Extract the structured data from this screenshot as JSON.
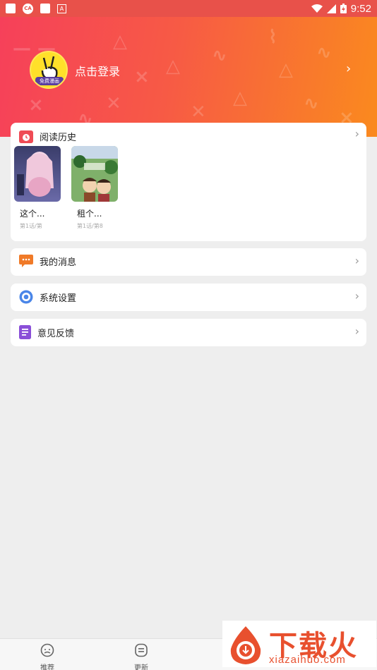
{
  "status_bar": {
    "notif_ca": "CA",
    "notif_a": "A",
    "time": "9:52",
    "battery_indicator": "⬍"
  },
  "header": {
    "avatar_badge": "免费漫画",
    "login_label": "点击登录",
    "chevron": "›"
  },
  "reading_history": {
    "title": "阅读历史",
    "books": [
      {
        "title": "这个...",
        "progress": "第1话/第"
      },
      {
        "title": "租个...",
        "progress": "第1话/第8"
      }
    ]
  },
  "menu": {
    "messages": "我的消息",
    "settings": "系统设置",
    "feedback": "意见反馈"
  },
  "chevron_right": "›",
  "bottom_nav": {
    "tabs": [
      {
        "label": "推荐",
        "icon": "recommend-face-icon"
      },
      {
        "label": "更新",
        "icon": "update-list-icon"
      }
    ]
  },
  "watermark": {
    "text": "下载火",
    "url": "xiazaihuo.com"
  },
  "colors": {
    "gradient_start": "#f6405a",
    "gradient_end": "#fa8a1e",
    "background": "#eeeeee"
  }
}
